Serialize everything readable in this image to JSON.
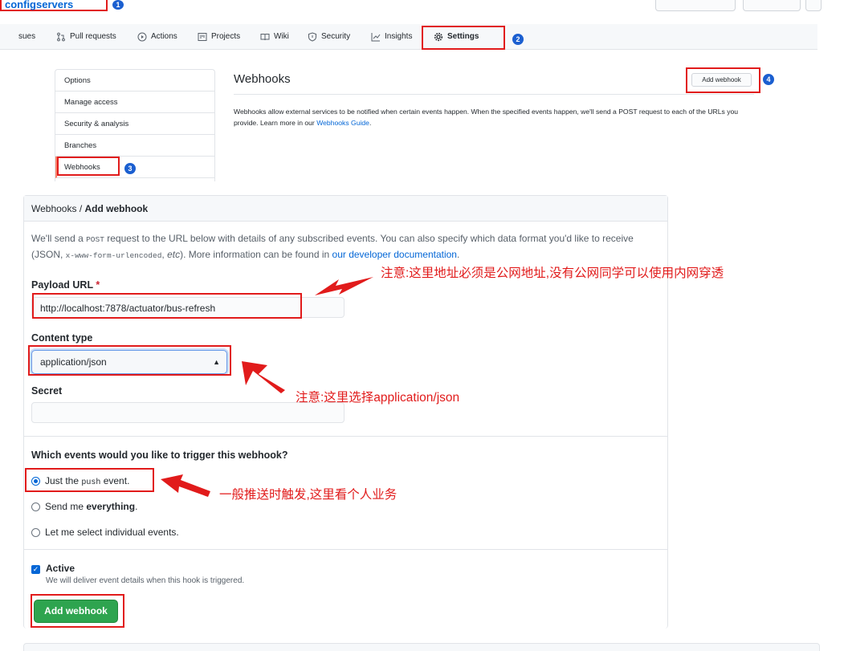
{
  "repo": {
    "name": "configservers"
  },
  "badges": [
    "1",
    "2",
    "3",
    "4"
  ],
  "nav": {
    "tabs": [
      {
        "label": "sues",
        "icon": "issues-icon"
      },
      {
        "label": "Pull requests",
        "icon": "pull-request-icon"
      },
      {
        "label": "Actions",
        "icon": "play-icon"
      },
      {
        "label": "Projects",
        "icon": "project-icon"
      },
      {
        "label": "Wiki",
        "icon": "book-icon"
      },
      {
        "label": "Security",
        "icon": "shield-icon"
      },
      {
        "label": "Insights",
        "icon": "graph-icon"
      },
      {
        "label": "Settings",
        "icon": "gear-icon"
      }
    ]
  },
  "settings_menu": {
    "items": [
      "Options",
      "Manage access",
      "Security & analysis",
      "Branches",
      "Webhooks"
    ]
  },
  "webhooks": {
    "title": "Webhooks",
    "add_button": "Add webhook",
    "description": "Webhooks allow external services to be notified when certain events happen. When the specified events happen, we'll send a POST request to each of the URLs you provide. Learn more in our ",
    "guide_link": "Webhooks Guide",
    "desc_end": "."
  },
  "form": {
    "breadcrumb_parent": "Webhooks / ",
    "breadcrumb_current": "Add webhook",
    "intro_1": "We'll send a ",
    "intro_post": "POST",
    "intro_2": " request to the URL below with details of any subscribed events. You can also specify which data format you'd like to receive (JSON, ",
    "intro_code": "x-www-form-urlencoded",
    "intro_3": ", ",
    "intro_etc": "etc",
    "intro_4": "). More information can be found in ",
    "intro_link": "our developer documentation",
    "intro_5": ".",
    "payload_label": "Payload URL",
    "payload_required": "*",
    "payload_value": "http://localhost:7878/actuator/bus-refresh",
    "content_type_label": "Content type",
    "content_type_value": "application/json",
    "secret_label": "Secret",
    "secret_value": "",
    "events_question": "Which events would you like to trigger this webhook?",
    "event_push_1": "Just the ",
    "event_push_code": "push",
    "event_push_2": " event.",
    "event_all_1": "Send me ",
    "event_all_2": "everything",
    "event_all_3": ".",
    "event_select": "Let me select individual events.",
    "active_label": "Active",
    "active_note": "We will deliver event details when this hook is triggered.",
    "submit_label": "Add webhook"
  },
  "annotations": {
    "note_url": "注意:这里地址必须是公网地址,没有公网同学可以使用内网穿透",
    "note_type": "注意:这里选择application/json",
    "note_event": "一般推送时触发,这里看个人业务"
  },
  "colors": {
    "annotation": "#e11b1b",
    "badge": "#1b5fd0",
    "primary_button": "#2ea44f",
    "link": "#0366d6"
  }
}
